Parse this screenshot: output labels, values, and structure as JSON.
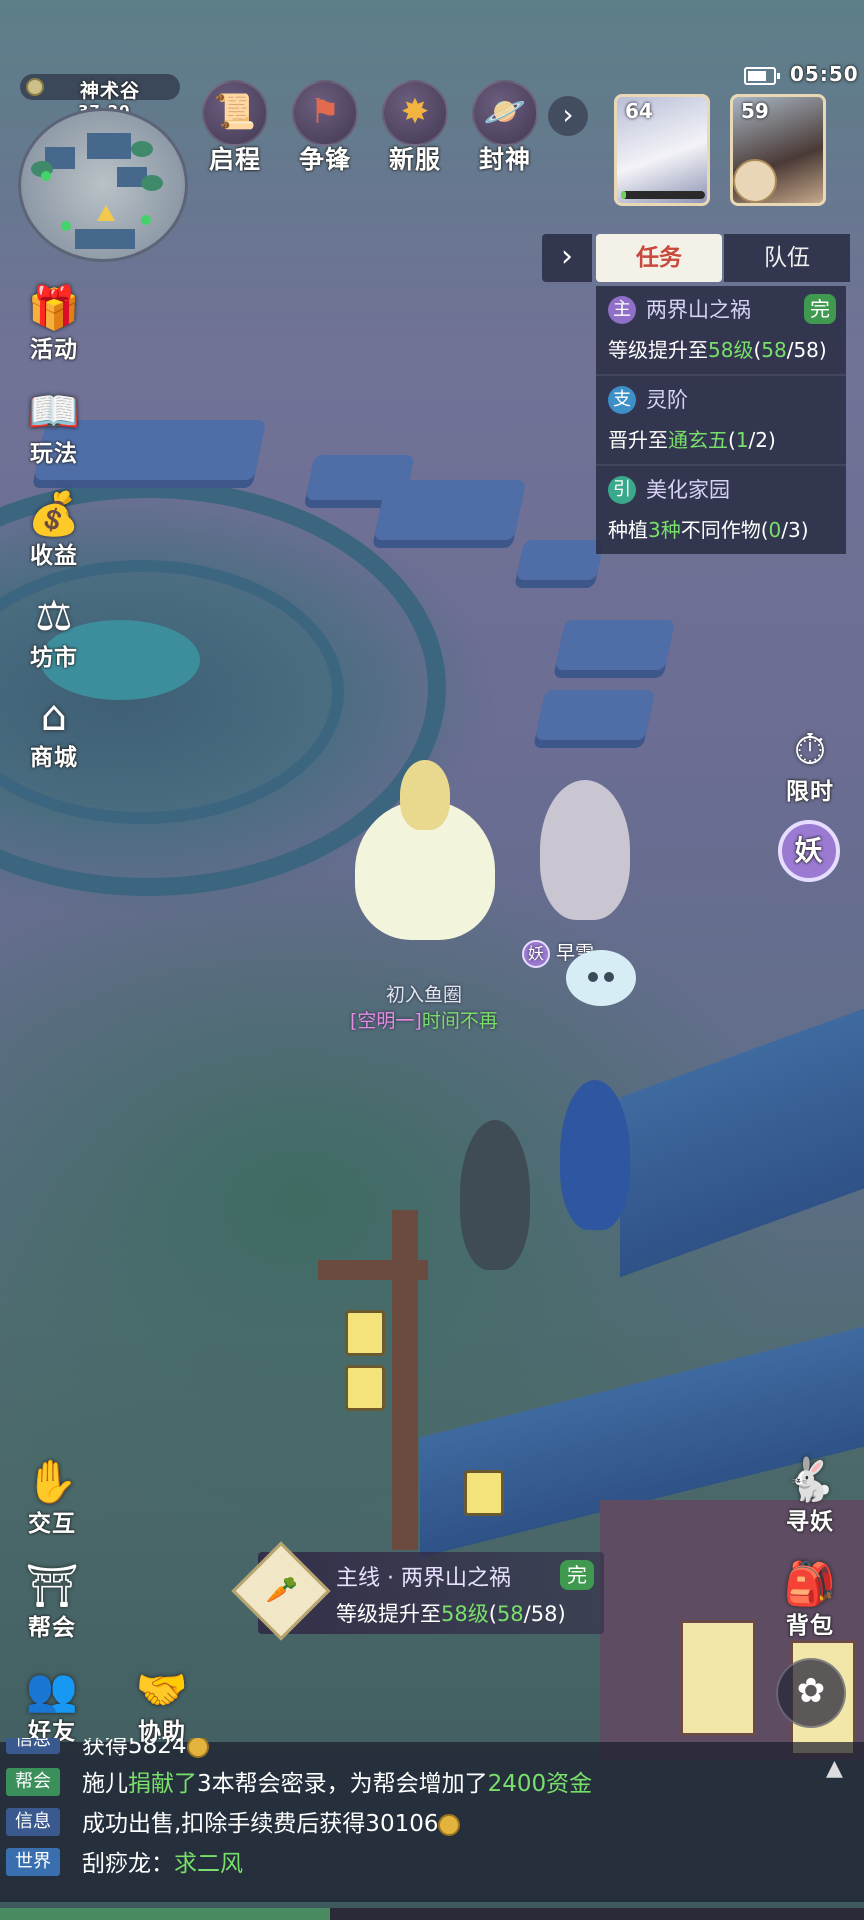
{
  "status_bar": {
    "time": "05:50"
  },
  "minimap": {
    "location": "神术谷",
    "coords": "37,20"
  },
  "top_menu": [
    {
      "label": "启程",
      "icon": "scroll-icon"
    },
    {
      "label": "争锋",
      "icon": "flag-icon"
    },
    {
      "label": "新服",
      "icon": "firework-icon"
    },
    {
      "label": "封神",
      "icon": "planet-icon"
    }
  ],
  "party": [
    {
      "level": "64",
      "hp_fraction": 0.06
    },
    {
      "level": "59"
    }
  ],
  "task_panel": {
    "tabs": [
      "任务",
      "队伍"
    ],
    "active_tab": "任务",
    "tasks": [
      {
        "badge": "主",
        "badge_color": "#8f6fc8",
        "name": "两界山之祸",
        "done": "完",
        "desc_prefix": "等级提升至",
        "desc_highlight": "58级",
        "desc_progress_open": "(",
        "desc_progress_done": "58",
        "desc_progress_total": "/58)"
      },
      {
        "badge": "支",
        "badge_color": "#3d8fc8",
        "name": "灵阶",
        "desc_prefix": "晋升至",
        "desc_highlight": "通玄五",
        "desc_progress_open": "(",
        "desc_progress_done": "1",
        "desc_progress_total": "/2)"
      },
      {
        "badge": "引",
        "badge_color": "#3aa88a",
        "name": "美化家园",
        "desc_prefix": "种植",
        "desc_highlight": "3种",
        "desc_mid": "不同作物",
        "desc_progress_open": "(",
        "desc_progress_done": "0",
        "desc_progress_total": "/3)"
      }
    ]
  },
  "left_menu": [
    "活动",
    "玩法",
    "收益",
    "坊市",
    "商城"
  ],
  "right_menu": {
    "timed": "限时",
    "yao": "妖"
  },
  "scene": {
    "player_title": "初入鱼圈",
    "player_guild_tag": "[空明一]",
    "player_name": "时间不再",
    "pet_badge": "妖",
    "pet_name": "早雪"
  },
  "bottom_left": [
    "交互",
    "帮会",
    "好友",
    "协助"
  ],
  "bottom_right": [
    "寻妖",
    "背包"
  ],
  "quest_tracker": {
    "title": "主线 · 两界山之祸",
    "done": "完",
    "desc_prefix": "等级提升至",
    "desc_highlight": "58级",
    "progress_open": "(",
    "progress_done": "58",
    "progress_total": "/58)"
  },
  "chat": [
    {
      "channel": "信息",
      "channel_color": "#3a5a8f",
      "text": "获得5824"
    },
    {
      "channel": "帮会",
      "channel_color": "#3a8f5a",
      "text_a": "施儿",
      "text_b": "捐献了",
      "text_c": "3本帮会密录",
      "text_d": "，为帮会增加了",
      "text_e": "2400资金"
    },
    {
      "channel": "信息",
      "channel_color": "#3a5a8f",
      "text": "成功出售,扣除手续费后获得30106"
    },
    {
      "channel": "世界",
      "channel_color": "#3a6faf",
      "text_a": "刮痧龙",
      "text_b": "：",
      "text_c": "求二风"
    }
  ]
}
